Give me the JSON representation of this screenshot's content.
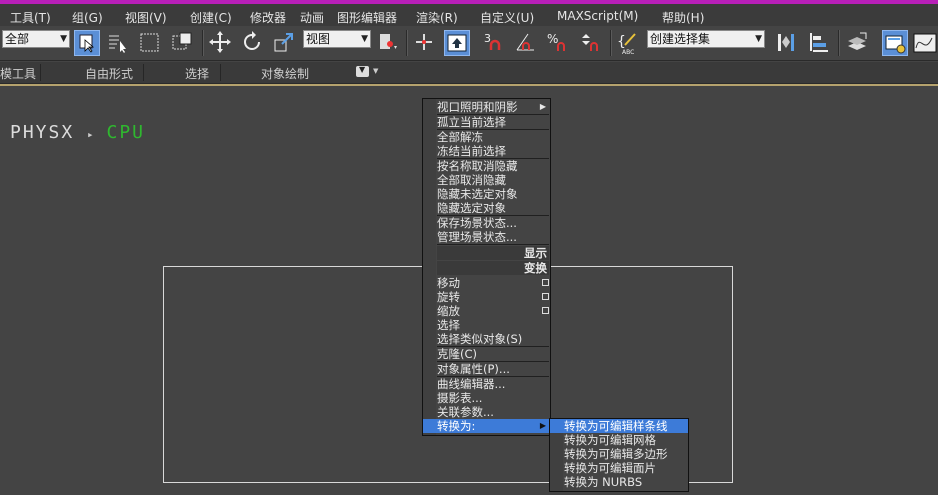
{
  "menubar": {
    "items": [
      "工具(T)",
      "组(G)",
      "视图(V)",
      "创建(C)",
      "修改器",
      "动画",
      "图形编辑器",
      "渲染(R)",
      "自定义(U)",
      "MAXScript(M)",
      "帮助(H)"
    ]
  },
  "toolbar": {
    "selection_filter": "全部",
    "reference_coord": "视图",
    "named_selection_set": "创建选择集"
  },
  "ribbon": {
    "tabs": [
      "模工具",
      "自由形式",
      "选择",
      "对象绘制"
    ]
  },
  "viewport": {
    "physx_label": "PHYSX",
    "cpu_label": "CPU"
  },
  "quad_menu": {
    "display_items": [
      "视口照明和阴影",
      "孤立当前选择",
      "全部解冻",
      "冻结当前选择",
      "按名称取消隐藏",
      "全部取消隐藏",
      "隐藏未选定对象",
      "隐藏选定对象",
      "保存场景状态...",
      "管理场景状态..."
    ],
    "display_header": "显示",
    "transform_header": "变换",
    "transform_items": [
      "移动",
      "旋转",
      "缩放",
      "选择",
      "选择类似对象(S)",
      "克隆(C)",
      "对象属性(P)...",
      "曲线编辑器...",
      "摄影表...",
      "关联参数...",
      "转换为:"
    ],
    "convert_submenu": [
      "转换为可编辑样条线",
      "转换为可编辑网格",
      "转换为可编辑多边形",
      "转换为可编辑面片",
      "转换为 NURBS"
    ]
  },
  "colors": {
    "accent": "#3d7bd8",
    "physx_green": "#2fb82f",
    "title_magenta": "#b81fb8"
  }
}
